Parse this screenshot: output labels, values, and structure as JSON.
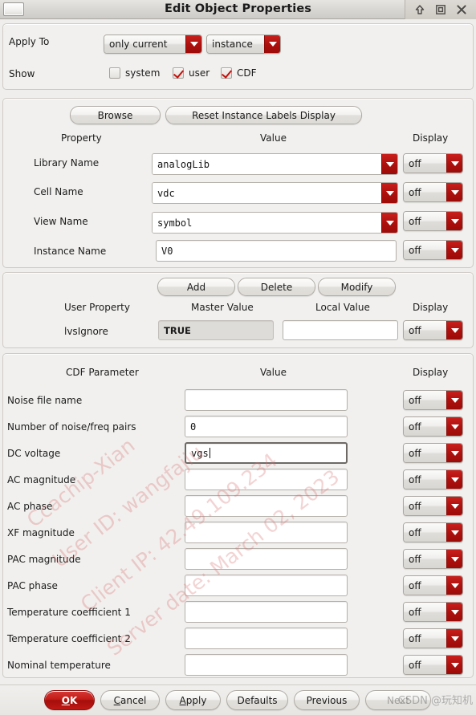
{
  "window": {
    "title": "Edit Object Properties",
    "controls": [
      {
        "name": "shade-icon",
        "label": "shade"
      },
      {
        "name": "maximize-icon",
        "label": "maximize"
      },
      {
        "name": "close-icon",
        "label": "close"
      }
    ]
  },
  "apply_panel": {
    "apply_to_label": "Apply To",
    "apply_to_scope": "only current",
    "apply_to_target": "instance",
    "show_label": "Show",
    "checkboxes": [
      {
        "label": "system",
        "checked": false
      },
      {
        "label": "user",
        "checked": true
      },
      {
        "label": "CDF",
        "checked": true
      }
    ]
  },
  "property_panel": {
    "browse_button": "Browse",
    "reset_button": "Reset Instance Labels Display",
    "headers": {
      "property": "Property",
      "value": "Value",
      "display": "Display"
    },
    "rows": [
      {
        "label": "Library Name",
        "value": "analogLib",
        "display": "off",
        "kind": "combo"
      },
      {
        "label": "Cell Name",
        "value": "vdc",
        "display": "off",
        "kind": "combo"
      },
      {
        "label": "View Name",
        "value": "symbol",
        "display": "off",
        "kind": "combo"
      },
      {
        "label": "Instance Name",
        "value": "V0",
        "display": "off",
        "kind": "entry"
      }
    ]
  },
  "user_property_panel": {
    "buttons": [
      "Add",
      "Delete",
      "Modify"
    ],
    "headers": {
      "user_property": "User Property",
      "master_value": "Master Value",
      "local_value": "Local Value",
      "display": "Display"
    },
    "rows": [
      {
        "label": "lvsIgnore",
        "master_value": "TRUE",
        "local_value": "",
        "display": "off"
      }
    ]
  },
  "cdf_panel": {
    "headers": {
      "parameter": "CDF Parameter",
      "value": "Value",
      "display": "Display"
    },
    "rows": [
      {
        "label": "Noise file name",
        "value": "",
        "display": "off",
        "focused": false
      },
      {
        "label": "Number of noise/freq pairs",
        "value": "0",
        "display": "off",
        "focused": false
      },
      {
        "label": "DC voltage",
        "value": "vgs",
        "display": "off",
        "focused": true
      },
      {
        "label": "AC magnitude",
        "value": "",
        "display": "off",
        "focused": false
      },
      {
        "label": "AC phase",
        "value": "",
        "display": "off",
        "focused": false
      },
      {
        "label": "XF magnitude",
        "value": "",
        "display": "off",
        "focused": false
      },
      {
        "label": "PAC magnitude",
        "value": "",
        "display": "off",
        "focused": false
      },
      {
        "label": "PAC phase",
        "value": "",
        "display": "off",
        "focused": false
      },
      {
        "label": "Temperature coefficient 1",
        "value": "",
        "display": "off",
        "focused": false
      },
      {
        "label": "Temperature coefficient 2",
        "value": "",
        "display": "off",
        "focused": false
      },
      {
        "label": "Nominal temperature",
        "value": "",
        "display": "off",
        "focused": false
      }
    ]
  },
  "bottom_bar": {
    "buttons": [
      {
        "name": "ok-button",
        "label": "OK",
        "accel": "O",
        "primary": true
      },
      {
        "name": "cancel-button",
        "label": "Cancel",
        "accel": "C",
        "primary": false
      },
      {
        "name": "apply-button",
        "label": "Apply",
        "accel": "A",
        "primary": false
      },
      {
        "name": "defaults-button",
        "label": "Defaults",
        "accel": "",
        "primary": false
      },
      {
        "name": "previous-button",
        "label": "Previous",
        "accel": "",
        "primary": false
      },
      {
        "name": "next-button",
        "label": "Next",
        "accel": "",
        "primary": false
      }
    ]
  },
  "watermark": {
    "lines": [
      "Ccachip-Xian",
      "User ID: wangfajiu",
      "Client IP: 42.49.109.234",
      "Server date: March 02, 2023"
    ],
    "corner": "CSDN @玩知机",
    "color": "#d66e6e"
  },
  "colors": {
    "accent_red": "#ad100d",
    "window_bg": "#efeeec",
    "panel_bg": "#f1f0ee"
  }
}
